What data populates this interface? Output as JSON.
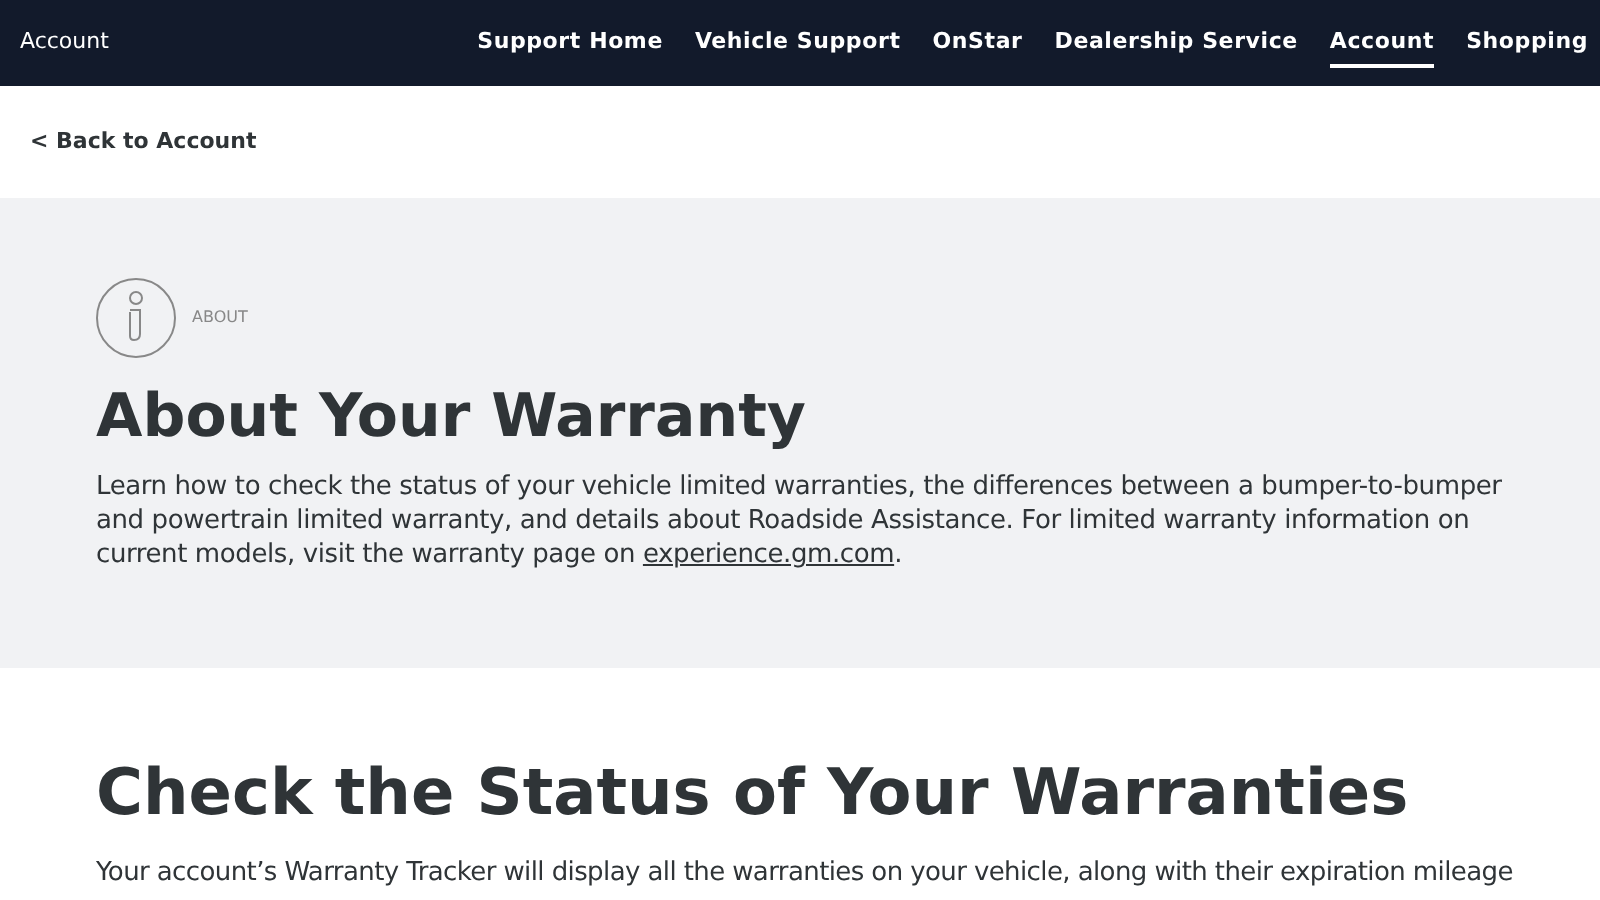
{
  "header": {
    "title": "Account",
    "nav": [
      {
        "label": "Support Home",
        "selected": false
      },
      {
        "label": "Vehicle Support",
        "selected": false
      },
      {
        "label": "OnStar",
        "selected": false
      },
      {
        "label": "Dealership Service",
        "selected": false
      },
      {
        "label": "Account",
        "selected": true
      },
      {
        "label": "Shopping",
        "selected": false
      }
    ]
  },
  "back_link": "< Back to Account",
  "hero": {
    "eyebrow": "ABOUT",
    "title": "About Your Warranty",
    "body": "Learn how to check the status of your vehicle limited warranties, the differences between a bumper-to-bumper and powertrain limited warranty, and details about Roadside Assistance. For limited warranty information on current models, visit the warranty page on ",
    "link": "experience.gm.com",
    "body_end": "."
  },
  "section": {
    "title": "Check the Status of Your Warranties",
    "body": "Your account’s Warranty Tracker will display all the warranties on your vehicle, along with their expiration mileage"
  }
}
